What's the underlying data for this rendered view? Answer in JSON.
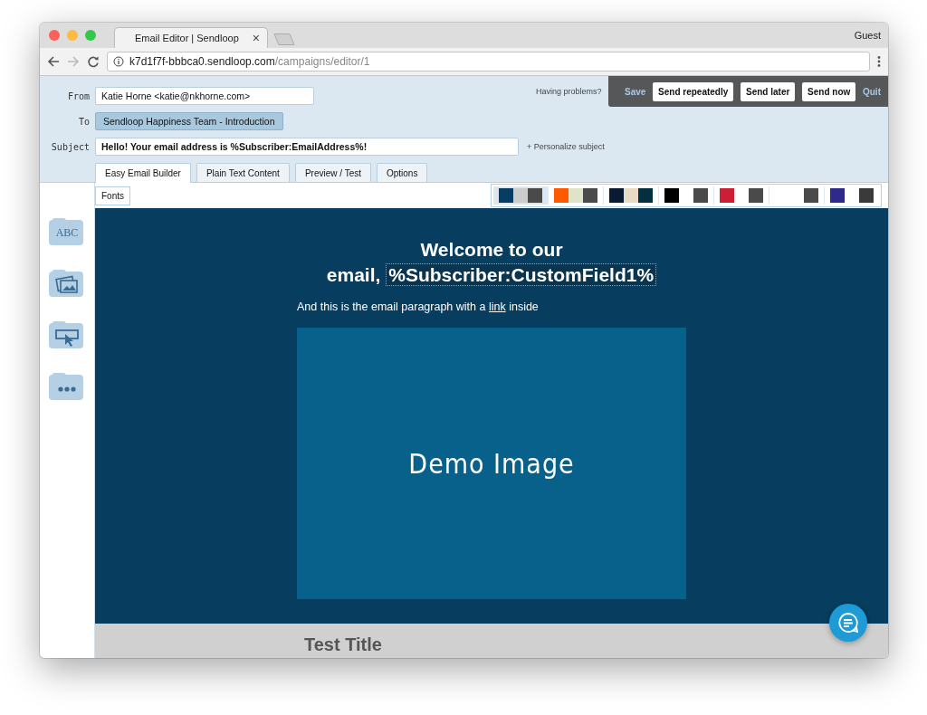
{
  "browser": {
    "tab_title": "Email Editor | Sendloop",
    "tab_close": "×",
    "profile": "Guest",
    "url_host": "k7d1f7f-bbbca0.sendloop.com",
    "url_path": "/campaigns/editor/1"
  },
  "fields": [
    {
      "label": "From",
      "value": "Katie Horne <katie@nkhorne.com>",
      "kind": "input"
    },
    {
      "label": "To",
      "value": "Sendloop Happiness Team - Introduction",
      "kind": "chip"
    },
    {
      "label": "Subject",
      "value": "Hello! Your email address is %Subscriber:EmailAddress%!",
      "kind": "input"
    }
  ],
  "personalize_link": "+ Personalize subject",
  "help_link": "Having problems?",
  "actions": [
    {
      "label": "Save",
      "kind": "link"
    },
    {
      "label": "Send repeatedly",
      "kind": "button"
    },
    {
      "label": "Send later",
      "kind": "button"
    },
    {
      "label": "Send now",
      "kind": "button"
    },
    {
      "label": "Quit",
      "kind": "link"
    }
  ],
  "tabs": [
    {
      "label": "Easy Email Builder",
      "selected": true
    },
    {
      "label": "Plain Text Content",
      "selected": false
    },
    {
      "label": "Preview / Test",
      "selected": false
    },
    {
      "label": "Options",
      "selected": false
    }
  ],
  "fonts_button": "Fonts",
  "text_block_label": "ABC",
  "palettes": [
    {
      "swatches": [
        {
          "color": "#063e63"
        },
        {
          "color": "#cccccc"
        },
        {
          "color": "#4a4a4a"
        }
      ],
      "selected": true
    },
    {
      "swatches": [
        {
          "color": "#ff5a00"
        },
        {
          "color": "#dfe3c8"
        },
        {
          "color": "#4a4a4a"
        }
      ],
      "selected": false
    },
    {
      "swatches": [
        {
          "color": "#0a1a33"
        },
        {
          "color": "#e8dcc6"
        },
        {
          "color": "#02303f"
        }
      ],
      "selected": false
    },
    {
      "swatches": [
        {
          "color": "#000000"
        },
        {
          "color": "#4a4a4a"
        }
      ],
      "selected": false
    },
    {
      "swatches": [
        {
          "color": "#cc1f36"
        },
        {
          "color": "#4a4a4a"
        }
      ],
      "selected": false
    },
    {
      "swatches": [
        {
          "color": "#4a4a4a"
        }
      ],
      "selected": false
    },
    {
      "swatches": [
        {
          "color": "#2e2a8c"
        },
        {
          "color": "#3a3a3a"
        }
      ],
      "selected": false
    }
  ],
  "email": {
    "heading": [
      {
        "text": "Welcome to our"
      },
      {
        "text": "email,",
        "merge_tag": "%Subscriber:CustomField1%"
      }
    ],
    "paragraph_before": "And this is the email paragraph with a ",
    "link": "link",
    "paragraph_after": " inside",
    "image_label": "Demo Image",
    "next_title": "Test Title"
  }
}
